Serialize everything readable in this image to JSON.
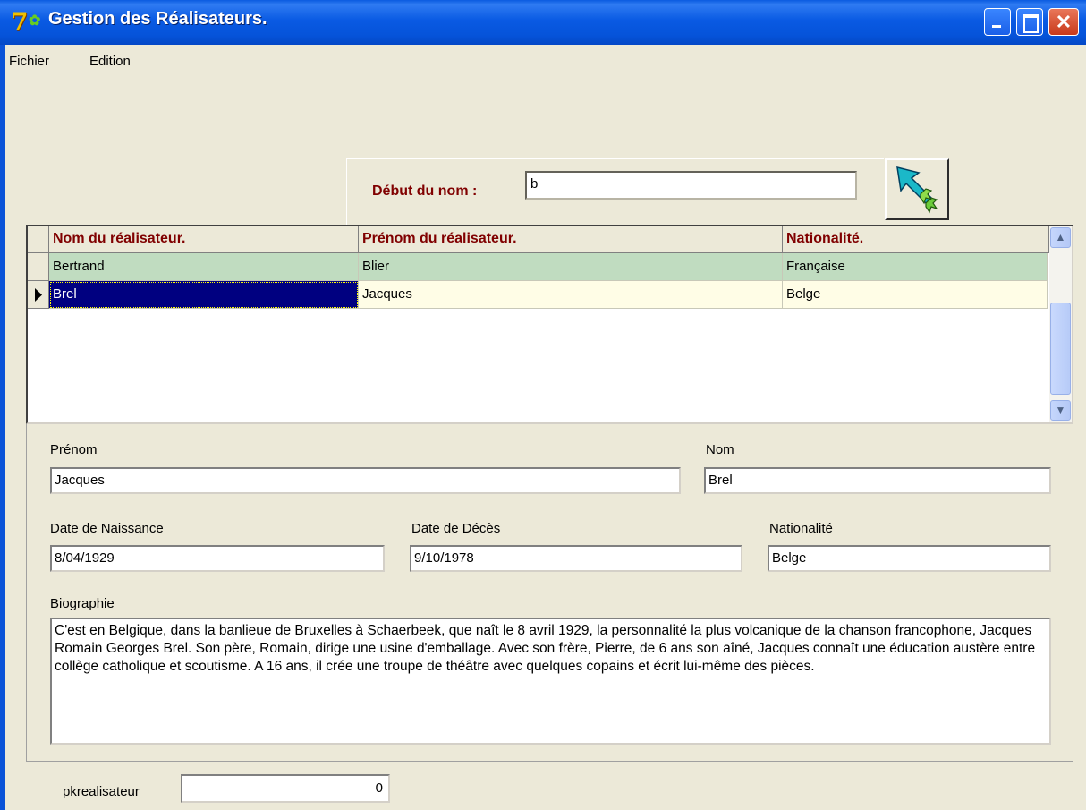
{
  "window": {
    "title": "Gestion des Réalisateurs."
  },
  "menu": {
    "items": [
      "Fichier",
      "Edition"
    ]
  },
  "search": {
    "label": "Début du nom :",
    "value": "b"
  },
  "grid": {
    "columns": [
      "Nom du réalisateur.",
      "Prénom du réalisateur.",
      "Nationalité."
    ],
    "rows": [
      {
        "nom": "Bertrand",
        "prenom": "Blier",
        "nationalite": "Française"
      },
      {
        "nom": "Brel",
        "prenom": "Jacques",
        "nationalite": "Belge"
      }
    ]
  },
  "detail": {
    "prenom_label": "Prénom",
    "prenom": "Jacques",
    "nom_label": "Nom",
    "nom": "Brel",
    "naissance_label": "Date de Naissance",
    "naissance": "8/04/1929",
    "deces_label": "Date de Décès",
    "deces": "9/10/1978",
    "nationalite_label": "Nationalité",
    "nationalite": "Belge",
    "bio_label": "Biographie",
    "bio": "C'est en Belgique, dans la banlieue de Bruxelles à Schaerbeek, que naît le 8 avril 1929, la personnalité la plus volcanique de la chanson francophone, Jacques Romain Georges Brel. Son père, Romain, dirige une usine d'emballage. Avec son frère, Pierre, de 6 ans son aîné, Jacques connaît une éducation austère entre collège catholique et scoutisme. A 16 ans, il crée une troupe de théâtre avec quelques copains et écrit lui-même des pièces."
  },
  "pk": {
    "label": "pkrealisateur",
    "value": "0"
  },
  "colors": {
    "header_text": "#800000",
    "row_alt": "#c0dcc0",
    "row_selected_bg": "#fffde6",
    "selection": "#000080",
    "titlebar": "#0a5be0"
  }
}
